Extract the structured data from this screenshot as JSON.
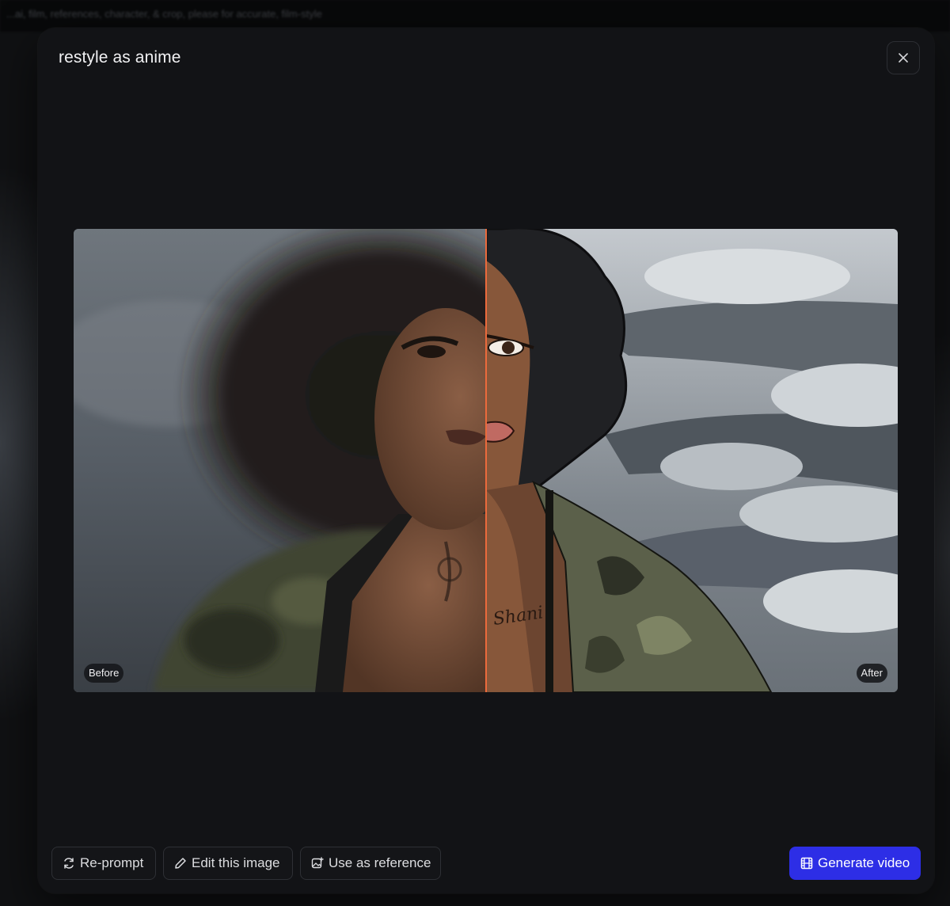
{
  "background_text": "...ai, film, references, character, & crop, please for accurate, film-style",
  "modal": {
    "title": "restyle as anime",
    "close_icon": "close-icon"
  },
  "compare": {
    "before_label": "Before",
    "after_label": "After",
    "divider_color": "#ec6a3c",
    "split_fraction": 0.5
  },
  "toolbar": {
    "reprompt_label": "Re-prompt",
    "edit_label": "Edit this image",
    "reference_label": "Use as reference",
    "generate_label": "Generate video"
  },
  "colors": {
    "accent": "#2d2ee6",
    "modal_bg": "#121316"
  }
}
